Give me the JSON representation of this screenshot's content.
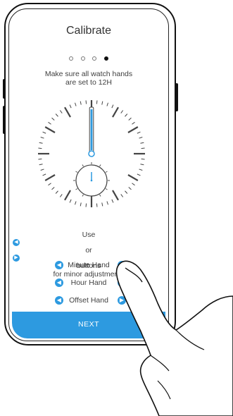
{
  "screen": {
    "title": "Calibrate",
    "step_total": 4,
    "step_active": 4,
    "instruction_line1": "Make sure all watch hands",
    "instruction_line2": "are set to 12H",
    "adjust_prefix": "Use",
    "adjust_or": "or",
    "adjust_suffix": "buttons",
    "adjust_line2": "for minor adjustments",
    "left_icon": "chevron-left-icon",
    "right_icon": "chevron-right-icon",
    "rows": [
      {
        "label": "Minute Hand"
      },
      {
        "label": "Hour Hand"
      },
      {
        "label": "Offset Hand"
      }
    ],
    "next_label": "NEXT"
  },
  "colors": {
    "accent": "#2d9ae0",
    "text": "#3b3b3b",
    "outline": "#111111"
  }
}
